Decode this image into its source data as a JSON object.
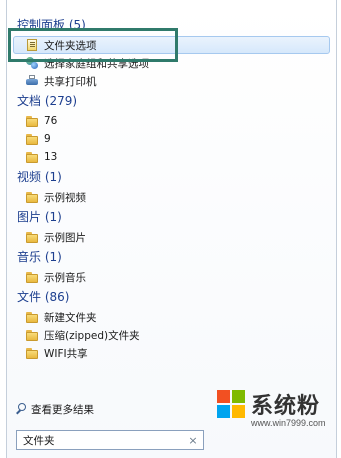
{
  "groups": [
    {
      "header": "控制面板 (5)",
      "items": [
        {
          "label": "文件夹选项",
          "icon": "folder-options-icon",
          "selected": true
        },
        {
          "label": "选择家庭组和共享选项",
          "icon": "network-icon",
          "selected": false
        },
        {
          "label": "共享打印机",
          "icon": "printer-icon",
          "selected": false
        }
      ]
    },
    {
      "header": "文档 (279)",
      "items": [
        {
          "label": "76",
          "icon": "folder-icon"
        },
        {
          "label": "9",
          "icon": "folder-icon"
        },
        {
          "label": "13",
          "icon": "folder-icon"
        }
      ]
    },
    {
      "header": "视频 (1)",
      "items": [
        {
          "label": "示例视频",
          "icon": "folder-icon"
        }
      ]
    },
    {
      "header": "图片 (1)",
      "items": [
        {
          "label": "示例图片",
          "icon": "folder-icon"
        }
      ]
    },
    {
      "header": "音乐 (1)",
      "items": [
        {
          "label": "示例音乐",
          "icon": "folder-icon"
        }
      ]
    },
    {
      "header": "文件 (86)",
      "items": [
        {
          "label": "新建文件夹",
          "icon": "folder-icon"
        },
        {
          "label": "压缩(zipped)文件夹",
          "icon": "folder-icon"
        },
        {
          "label": "WIFI共享",
          "icon": "folder-icon"
        }
      ]
    }
  ],
  "more_results": {
    "label": "查看更多结果",
    "icon": "search-icon"
  },
  "search": {
    "value": "文件夹",
    "clear_icon": "close-icon",
    "clear_glyph": "×"
  },
  "watermark": {
    "title": "系统粉",
    "url": "www.win7999.com",
    "logo_colors": [
      "#f25022",
      "#7fba00",
      "#00a4ef",
      "#ffb900"
    ]
  },
  "colors": {
    "group_header": "#1d3f8f",
    "highlight_border": "#2f7a6b",
    "selected_bg": "#d6e8fb"
  }
}
